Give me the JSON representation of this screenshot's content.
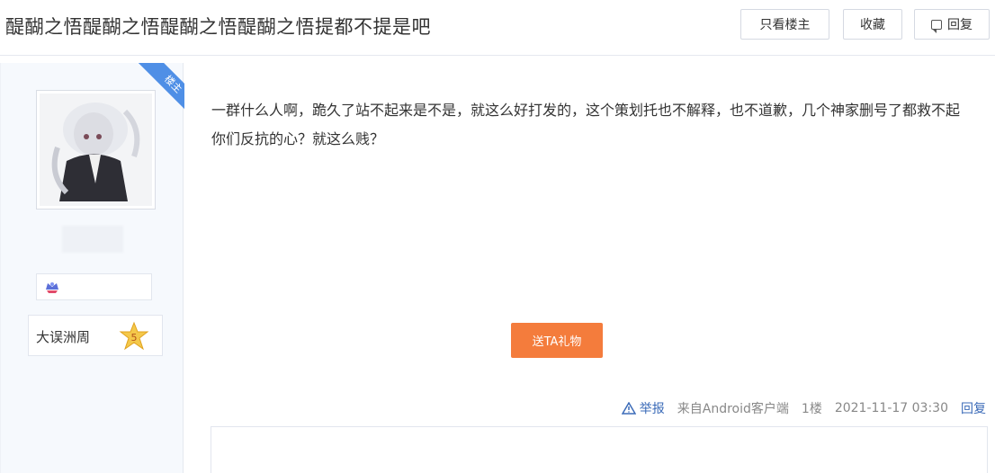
{
  "thread": {
    "title": "醍醐之悟醍醐之悟醍醐之悟醍醐之悟提都不提是吧"
  },
  "toolbar": {
    "only_op_label": "只看楼主",
    "favorite_label": "收藏",
    "reply_label": "回复"
  },
  "author": {
    "op_badge": "楼主",
    "level_name": "大误洲周",
    "level_number": "5"
  },
  "post": {
    "text": "一群什么人啊，跪久了站不起来是不是，就这么好打发的，这个策划托也不解释，也不道歉，几个神家删号了都救不起你们反抗的心？就这么贱？",
    "gift_label": "送TA礼物",
    "report_label": "举报",
    "source": "来自Android客户端",
    "floor": "1楼",
    "time": "2021-11-17 03:30",
    "reply_label": "回复"
  },
  "colors": {
    "accent": "#3b6bb8",
    "gift": "#f47c3c",
    "badge": "#4f8fe6"
  }
}
